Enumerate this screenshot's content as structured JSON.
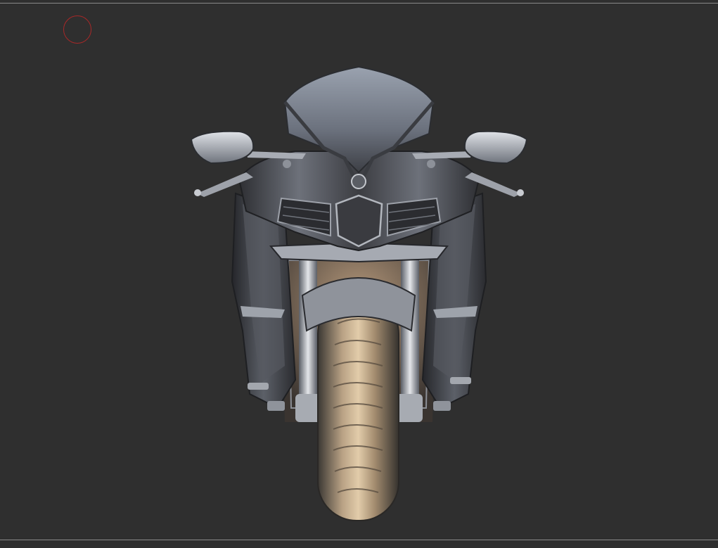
{
  "viewport": {
    "background": "#2f2f2f",
    "border_color": "#8a8a8a"
  },
  "brush_cursor": {
    "icon": "brush-circle-icon",
    "color": "#a82828"
  },
  "model": {
    "subject": "motorcycle-front-view",
    "material_colors": {
      "body_light": "#c9ccd3",
      "body_mid": "#858a94",
      "body_dark": "#3a3b3f",
      "tire_light": "#d8c3a0",
      "tire_dark": "#4a4742"
    }
  }
}
